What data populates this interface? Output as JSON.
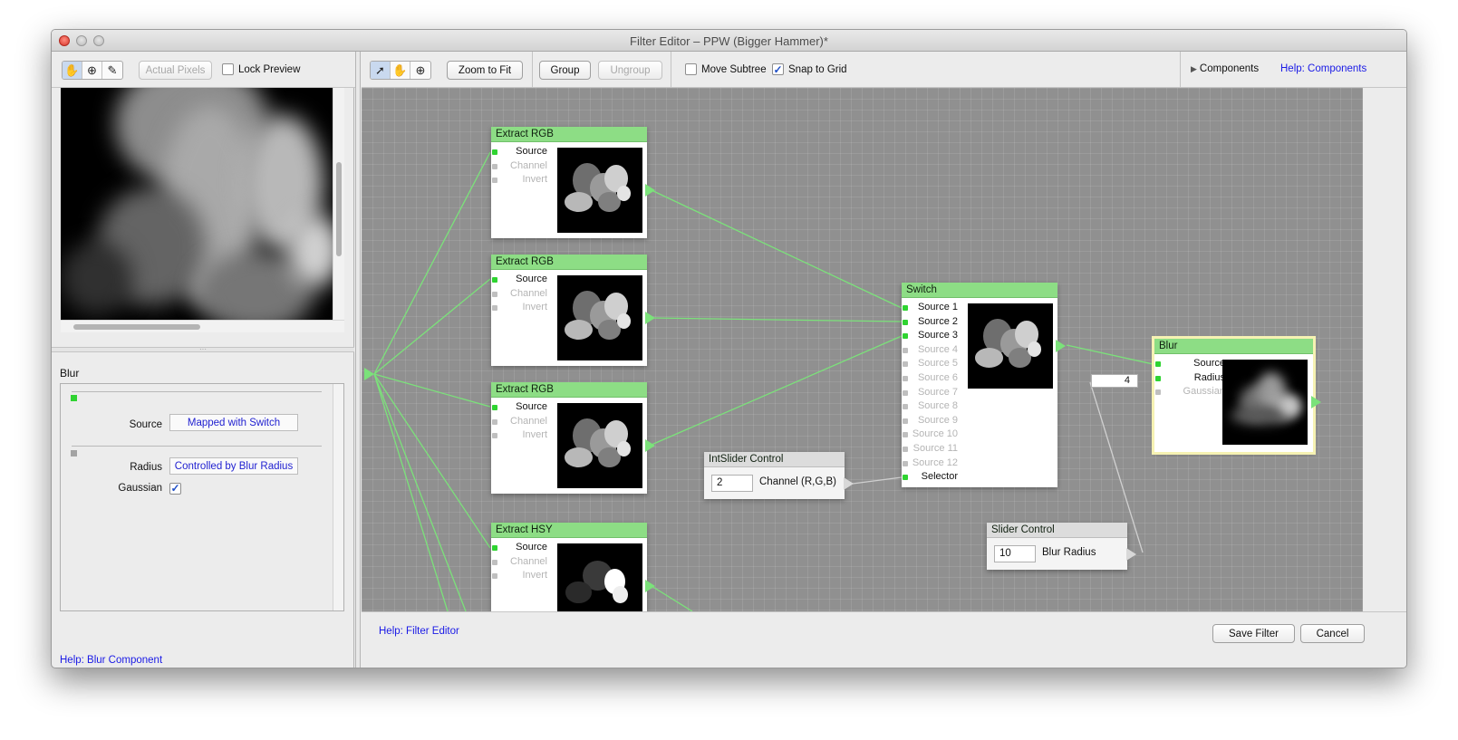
{
  "window": {
    "title": "Filter Editor – PPW (Bigger Hammer)*"
  },
  "preview_toolbar": {
    "tools": [
      "hand-icon",
      "zoom-icon",
      "eyedropper-icon"
    ],
    "actual_pixels_label": "Actual Pixels",
    "lock_preview_label": "Lock Preview",
    "lock_preview_checked": false
  },
  "inspector": {
    "title": "Blur",
    "source_label": "Source",
    "source_value": "Mapped with Switch",
    "radius_label": "Radius",
    "radius_value": "Controlled by Blur Radius",
    "gaussian_label": "Gaussian",
    "gaussian_checked": true,
    "help_link": "Help: Blur Component"
  },
  "editor_toolbar": {
    "tools": [
      "pointer-icon",
      "hand-icon",
      "zoom-icon"
    ],
    "zoom_to_fit_label": "Zoom to Fit",
    "group_label": "Group",
    "ungroup_label": "Ungroup",
    "move_subtree_label": "Move Subtree",
    "move_subtree_checked": false,
    "snap_to_grid_label": "Snap to Grid",
    "snap_to_grid_checked": true,
    "components_label": "Components",
    "help_components_label": "Help: Components"
  },
  "nodes": {
    "extract_rgb_1": {
      "title": "Extract RGB",
      "ports": [
        "Source",
        "Channel",
        "Invert"
      ]
    },
    "extract_rgb_2": {
      "title": "Extract RGB",
      "ports": [
        "Source",
        "Channel",
        "Invert"
      ]
    },
    "extract_rgb_3": {
      "title": "Extract RGB",
      "ports": [
        "Source",
        "Channel",
        "Invert"
      ]
    },
    "extract_hsy": {
      "title": "Extract HSY",
      "ports": [
        "Source",
        "Channel",
        "Invert"
      ]
    },
    "switch": {
      "title": "Switch",
      "ports": [
        "Source 1",
        "Source 2",
        "Source 3",
        "Source 4",
        "Source 5",
        "Source 6",
        "Source 7",
        "Source 8",
        "Source 9",
        "Source 10",
        "Source 11",
        "Source 12",
        "Selector"
      ]
    },
    "blur": {
      "title": "Blur",
      "ports": [
        "Source",
        "Radius",
        "Gaussian"
      ],
      "radius_value": "4"
    },
    "int_slider": {
      "title": "IntSlider Control",
      "value": "2",
      "label": "Channel (R,G,B)"
    },
    "slider": {
      "title": "Slider Control",
      "value": "10",
      "label": "Blur Radius"
    }
  },
  "footer": {
    "help_editor": "Help: Filter Editor",
    "save_filter_label": "Save Filter",
    "cancel_label": "Cancel"
  },
  "colors": {
    "node_header": "#8ddd85",
    "wire": "#7be27a",
    "link": "#1a1ae6",
    "canvas": "#909090"
  }
}
